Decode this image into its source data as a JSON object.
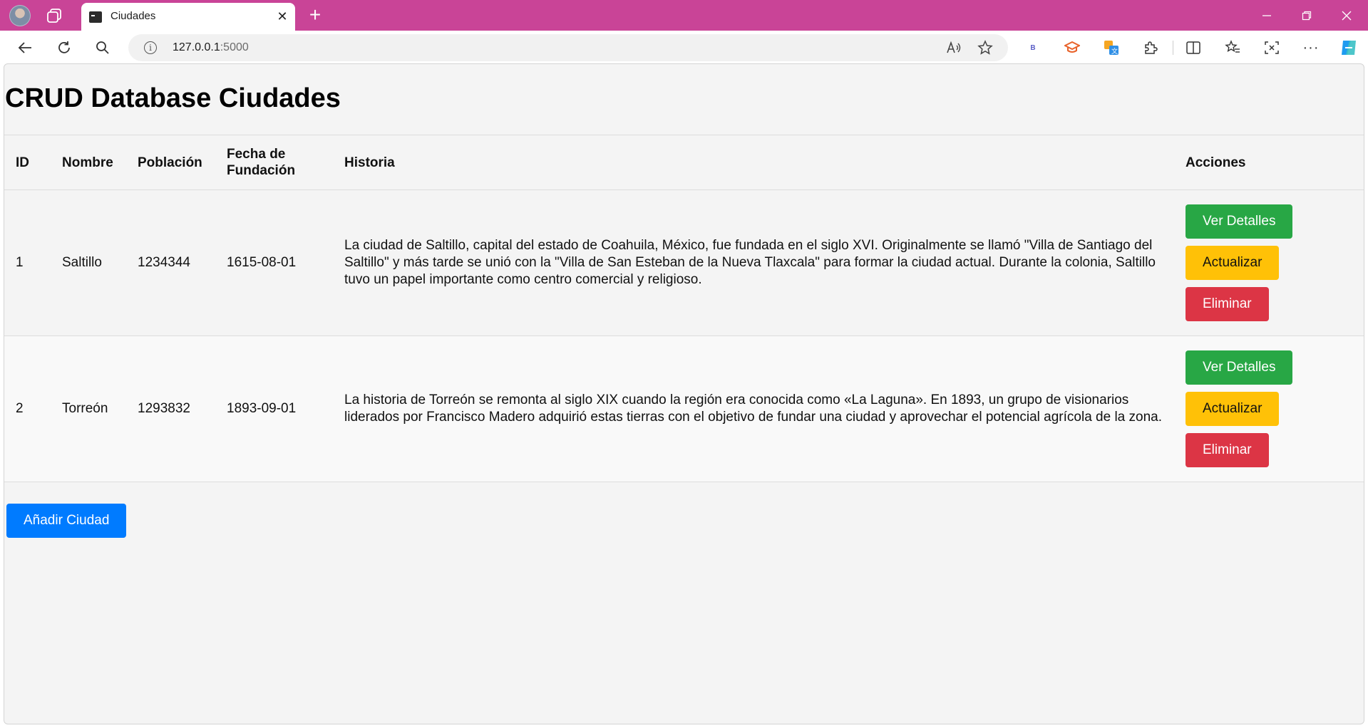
{
  "browser": {
    "tab_title": "Ciudades",
    "url_host": "127.0.0.1",
    "url_port": ":5000",
    "icons": {
      "profile": "profile-avatar",
      "workspaces": "workspaces-icon",
      "close": "close-icon",
      "new_tab": "plus-icon",
      "back": "back-arrow-icon",
      "refresh": "refresh-icon",
      "search": "search-icon",
      "info": "info-icon",
      "read_aloud": "read-aloud-icon",
      "favorite": "star-icon",
      "bing": "bing-icon",
      "extensions": "puzzle-icon",
      "split": "split-screen-icon",
      "favorites": "favorites-icon",
      "screenshot": "screenshot-icon",
      "more": "more-icon",
      "copilot": "copilot-icon"
    },
    "tab_bar_color": "#c94497"
  },
  "page": {
    "title": "CRUD Database Ciudades",
    "table": {
      "headers": {
        "id": "ID",
        "nombre": "Nombre",
        "poblacion": "Población",
        "fecha_line1": "Fecha de",
        "fecha_line2": "Fundación",
        "historia": "Historia",
        "acciones": "Acciones"
      },
      "rows": [
        {
          "id": "1",
          "nombre": "Saltillo",
          "poblacion": "1234344",
          "fecha": "1615-08-01",
          "historia": "La ciudad de Saltillo, capital del estado de Coahuila, México, fue fundada en el siglo XVI. Originalmente se llamó \"Villa de Santiago del Saltillo\" y más tarde se unió con la \"Villa de San Esteban de la Nueva Tlaxcala\" para formar la ciudad actual. Durante la colonia, Saltillo tuvo un papel importante como centro comercial y religioso."
        },
        {
          "id": "2",
          "nombre": "Torreón",
          "poblacion": "1293832",
          "fecha": "1893-09-01",
          "historia": "La historia de Torreón se remonta al siglo XIX cuando la región era conocida como «La Laguna». En 1893, un grupo de visionarios liderados por Francisco Madero adquirió estas tierras con el objetivo de fundar una ciudad y aprovechar el potencial agrícola de la zona."
        }
      ],
      "actions": {
        "details": "Ver Detalles",
        "update": "Actualizar",
        "delete": "Eliminar"
      }
    },
    "add_button": "Añadir Ciudad",
    "colors": {
      "success": "#28a745",
      "warning": "#ffc107",
      "danger": "#dc3545",
      "primary": "#007bff"
    }
  }
}
